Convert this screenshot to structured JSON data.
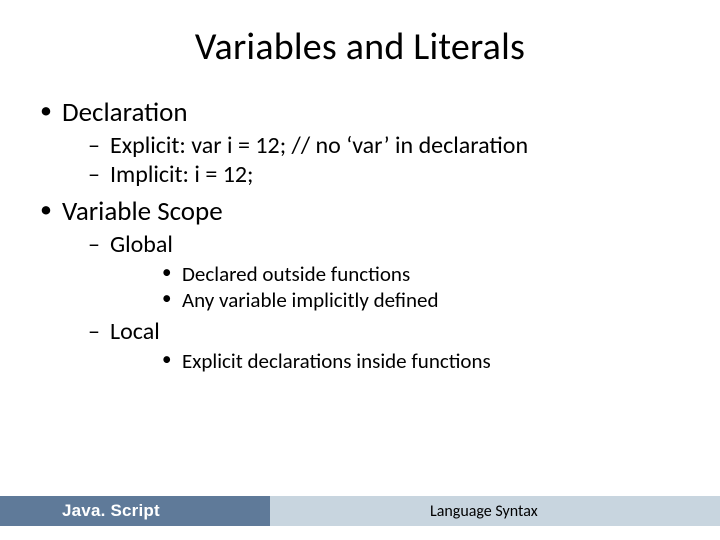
{
  "title": "Variables and Literals",
  "bullets": [
    {
      "text": "Declaration",
      "children": [
        {
          "text": "Explicit: var i = 12; // no ‘var’ in declaration"
        },
        {
          "text": "Implicit: i =  12;"
        }
      ]
    },
    {
      "text": "Variable Scope",
      "children": [
        {
          "text": "Global",
          "children": [
            {
              "text": "Declared outside functions"
            },
            {
              "text": "Any variable implicitly defined"
            }
          ]
        },
        {
          "text": "Local",
          "children": [
            {
              "text": "Explicit declarations inside functions"
            }
          ]
        }
      ]
    }
  ],
  "footer": {
    "left": "Java. Script",
    "right": "Language Syntax"
  }
}
